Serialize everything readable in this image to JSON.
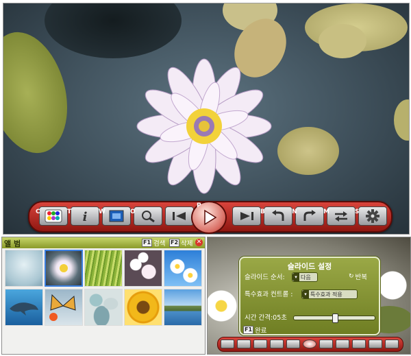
{
  "viewer": {
    "toolbar": {
      "buttons": [
        {
          "key": "C",
          "icon": "palette-icon"
        },
        {
          "key": "T",
          "icon": "info-icon"
        },
        {
          "key": "W",
          "icon": "fit-window-icon"
        },
        {
          "key": "O",
          "icon": "zoom-icon"
        },
        {
          "key": "",
          "icon": "previous-icon"
        },
        {
          "key": "P",
          "icon": "play-icon"
        },
        {
          "key": "",
          "icon": "next-icon"
        },
        {
          "key": "B",
          "icon": "rotate-left-icon"
        },
        {
          "key": "N",
          "icon": "rotate-right-icon"
        },
        {
          "key": "M",
          "icon": "swap-icon"
        },
        {
          "key": "S",
          "icon": "settings-gear-icon"
        }
      ],
      "accent": "#b7261e"
    }
  },
  "album": {
    "title": "앨 범",
    "search_key": "F1",
    "search_label": "검색",
    "delete_key": "F2",
    "delete_label": "삭제",
    "close_symbol": "✕",
    "accent": "#9aaa34",
    "thumbnails": [
      {
        "subject": "pale-blue-abstract",
        "selected": false
      },
      {
        "subject": "white-water-lily",
        "selected": true
      },
      {
        "subject": "green-grass",
        "selected": false
      },
      {
        "subject": "white-blossoms",
        "selected": false
      },
      {
        "subject": "daisies-blue-sky",
        "selected": false
      },
      {
        "subject": "dolphin-underwater",
        "selected": false
      },
      {
        "subject": "butterfly-on-flower",
        "selected": false
      },
      {
        "subject": "pebbles",
        "selected": false
      },
      {
        "subject": "sunflower",
        "selected": false
      },
      {
        "subject": "lake-landscape",
        "selected": false
      }
    ]
  },
  "slideshow_settings": {
    "title": "슬라이드 설정",
    "order_label": "슬라이드 순서:",
    "order_value": "다음",
    "repeat_label": "반복",
    "effect_label": "특수효과 컨트롤 :",
    "effect_value": "특수효과 적용",
    "interval_label": "시간 간격:05초",
    "interval_fraction": 0.5,
    "done_key": "F1",
    "done_label": "완료",
    "mini_toolbar_button_count": 11
  }
}
